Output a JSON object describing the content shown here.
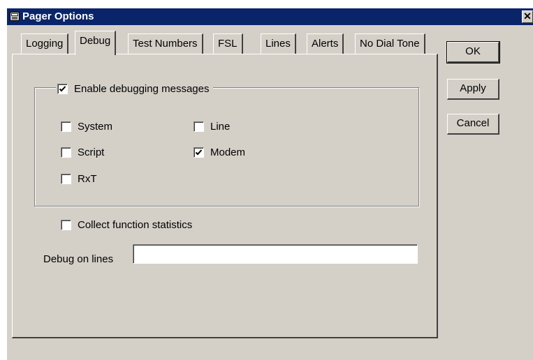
{
  "window": {
    "title": "Pager Options",
    "close_glyph": "✕"
  },
  "tabs": [
    {
      "label": "Logging"
    },
    {
      "label": "Debug",
      "active": true
    },
    {
      "label": "Test Numbers"
    },
    {
      "label": "FSL"
    },
    {
      "label": "Lines"
    },
    {
      "label": "Alerts"
    },
    {
      "label": "No Dial Tone"
    }
  ],
  "debug": {
    "enable_label": "Enable debugging messages",
    "enable_checked": true,
    "options": {
      "system": {
        "label": "System",
        "checked": false
      },
      "script": {
        "label": "Script",
        "checked": false
      },
      "rxt": {
        "label": "RxT",
        "checked": false
      },
      "line": {
        "label": "Line",
        "checked": false
      },
      "modem": {
        "label": "Modem",
        "checked": true
      }
    },
    "collect_label": "Collect function statistics",
    "collect_checked": false,
    "lines_label": "Debug on lines",
    "lines_value": ""
  },
  "buttons": {
    "ok": "OK",
    "apply": "Apply",
    "cancel": "Cancel"
  }
}
